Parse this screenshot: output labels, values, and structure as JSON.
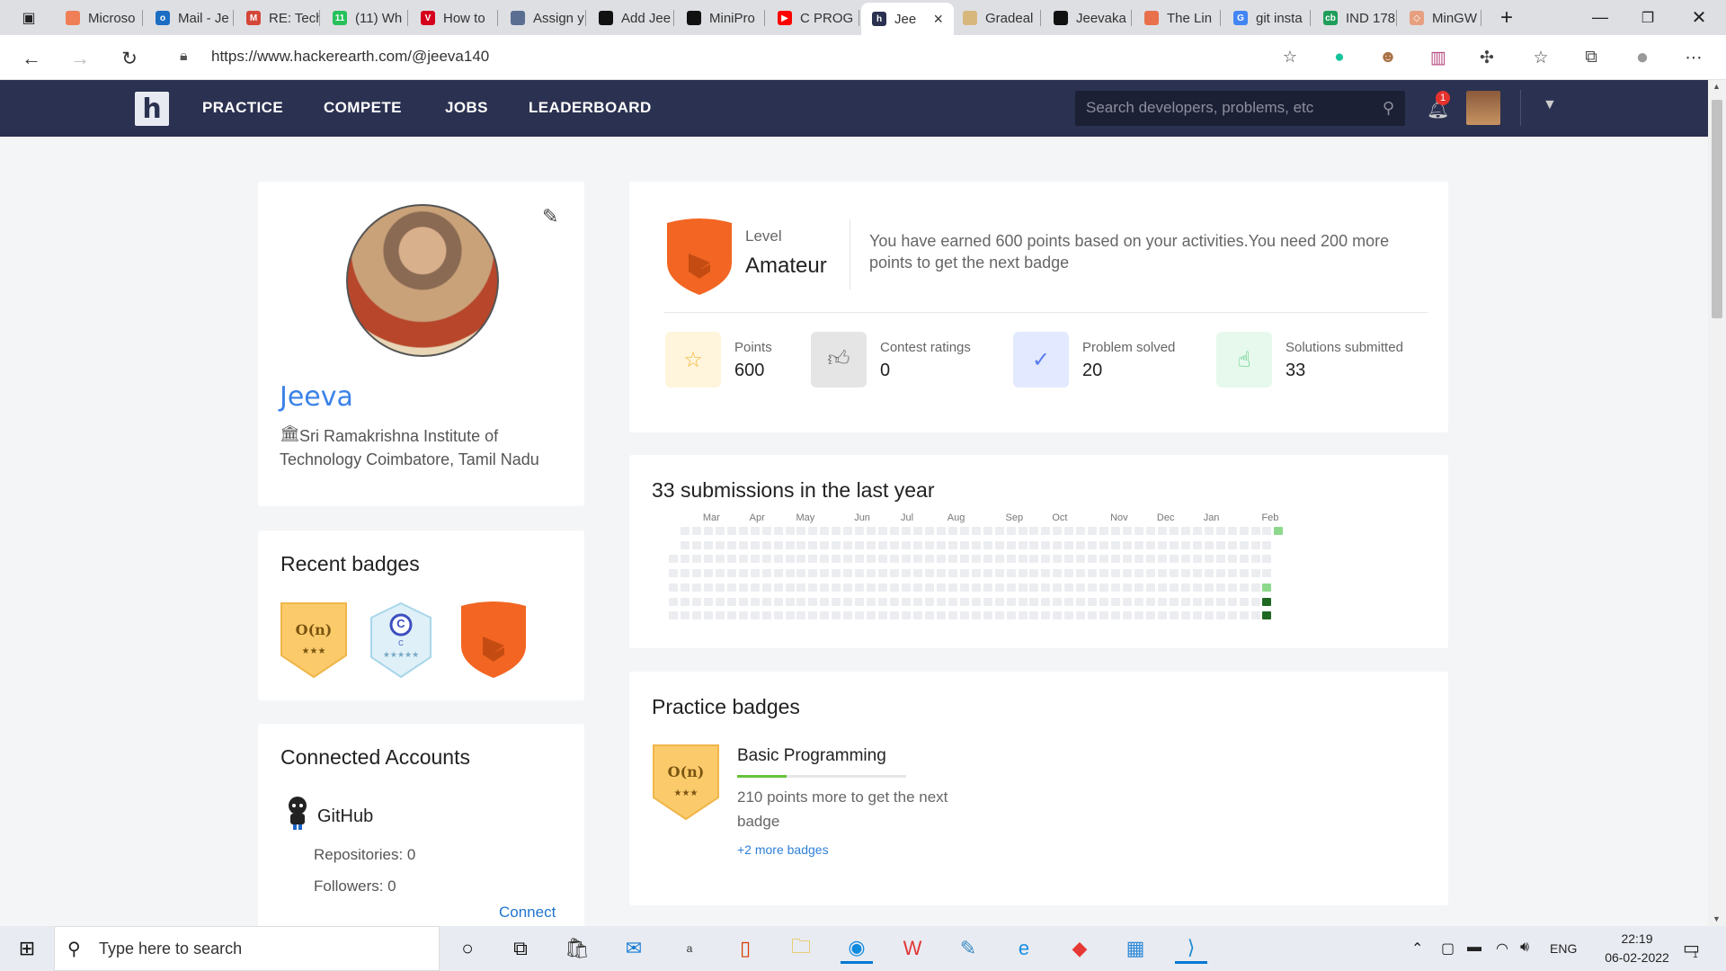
{
  "browser": {
    "tabs": [
      {
        "title": "Microso",
        "favicon_color": "#ef7f56",
        "favicon_glyph": "",
        "icon": "microsoft-icon"
      },
      {
        "title": "Mail - Je",
        "favicon_color": "#1b6ec2",
        "favicon_glyph": "o",
        "icon": "outlook-icon"
      },
      {
        "title": "RE: Tech",
        "favicon_color": "#d44638",
        "favicon_glyph": "M",
        "icon": "gmail-icon"
      },
      {
        "title": "(11) Wh",
        "favicon_color": "#25c15a",
        "favicon_glyph": "11",
        "icon": "whatsapp-icon"
      },
      {
        "title": "How to",
        "favicon_color": "#d5001c",
        "favicon_glyph": "V",
        "icon": "vivaldi-icon"
      },
      {
        "title": "Assign y",
        "favicon_color": "#5a6e92",
        "favicon_glyph": "",
        "icon": "assign-icon"
      },
      {
        "title": "Add Jee",
        "favicon_color": "#111111",
        "favicon_glyph": "",
        "icon": "github-icon"
      },
      {
        "title": "MiniPro",
        "favicon_color": "#111111",
        "favicon_glyph": "",
        "icon": "github-icon"
      },
      {
        "title": "C PROG",
        "favicon_color": "#ff0000",
        "favicon_glyph": "▶",
        "icon": "youtube-icon"
      },
      {
        "title": "Jee",
        "favicon_color": "#2b3150",
        "favicon_glyph": "h",
        "icon": "hackerearth-icon",
        "active": true
      },
      {
        "title": "Gradeal",
        "favicon_color": "#d8b77c",
        "favicon_glyph": "",
        "icon": "gradeal-icon"
      },
      {
        "title": "Jeevaka",
        "favicon_color": "#111111",
        "favicon_glyph": "",
        "icon": "github-icon"
      },
      {
        "title": "The Lin",
        "favicon_color": "#e8714c",
        "favicon_glyph": "",
        "icon": "ubuntu-icon"
      },
      {
        "title": "git insta",
        "favicon_color": "#4285f4",
        "favicon_glyph": "G",
        "icon": "google-icon"
      },
      {
        "title": "IND 178",
        "favicon_color": "#1f9e5a",
        "favicon_glyph": "cb",
        "icon": "cricbuzz-icon"
      },
      {
        "title": "MinGW",
        "favicon_color": "#e7a07f",
        "favicon_glyph": "◇",
        "icon": "mingw-icon"
      }
    ],
    "url": "https://www.hackerearth.com/@jeeva140"
  },
  "site": {
    "logo_glyph": "h",
    "nav": [
      "PRACTICE",
      "COMPETE",
      "JOBS",
      "LEADERBOARD"
    ],
    "search_placeholder": "Search developers, problems, etc",
    "notification_count": "1"
  },
  "profile": {
    "name": "Jeeva",
    "institute": "Sri Ramakrishna Institute of Technology Coimbatore, Tamil Nadu"
  },
  "recent_badges": {
    "title": "Recent badges",
    "badges": [
      {
        "icon": "on-complexity-badge-icon",
        "glyph": "O(n)",
        "stars": "★★★",
        "color": "#fbcb6b"
      },
      {
        "icon": "c-language-badge-icon",
        "glyph": "C",
        "sub": "C",
        "stars": "★★★★★",
        "color": "#dff0f8"
      },
      {
        "icon": "level-shield-badge-icon",
        "glyph": "",
        "stars": "",
        "color": "#f26522"
      }
    ]
  },
  "connected_accounts": {
    "title": "Connected Accounts",
    "service": "GitHub",
    "repositories": "Repositories: 0",
    "followers": "Followers: 0",
    "connect": "Connect"
  },
  "level": {
    "label": "Level",
    "value": "Amateur",
    "message": "You have earned 600 points based on your activities.You need 200 more points to get the next badge"
  },
  "stats": [
    {
      "label": "Points",
      "value": "600",
      "icon": "star-icon",
      "bg": "#fff5dc",
      "fg": "#f2b534"
    },
    {
      "label": "Contest ratings",
      "value": "0",
      "icon": "thumbs-up-icon",
      "bg": "#e5e5e5",
      "fg": "#777777"
    },
    {
      "label": "Problem solved",
      "value": "20",
      "icon": "check-circle-icon",
      "bg": "#e3e9ff",
      "fg": "#5a7cf0"
    },
    {
      "label": "Solutions submitted",
      "value": "33",
      "icon": "hand-pointer-icon",
      "bg": "#e6f9ec",
      "fg": "#41c46c"
    }
  ],
  "submissions": {
    "title": "33 submissions in the last year",
    "months": [
      "Mar",
      "Apr",
      "May",
      "Jun",
      "Jul",
      "Aug",
      "Sep",
      "Oct",
      "Nov",
      "Dec",
      "Jan",
      "Feb"
    ],
    "active_cells": [
      {
        "week": 52,
        "day": 0,
        "level": 1
      },
      {
        "week": 51,
        "day": 4,
        "level": 1
      },
      {
        "week": 51,
        "day": 5,
        "level": 3
      },
      {
        "week": 51,
        "day": 6,
        "level": 3
      }
    ],
    "colors": [
      "#ebedf0",
      "#8cd98c",
      "#44a340",
      "#1e6823"
    ]
  },
  "practice_badges": {
    "title": "Practice badges",
    "badge_name": "Basic Programming",
    "progress_fraction": 0.29,
    "progress_text": "210 points more to get the next badge",
    "more_link": "+2 more badges",
    "badge_glyph": "O(n)",
    "badge_stars": "★★★"
  },
  "taskbar": {
    "search_placeholder": "Type here to search",
    "language": "ENG",
    "time": "22:19",
    "date": "06-02-2022",
    "notification_count": "1"
  }
}
